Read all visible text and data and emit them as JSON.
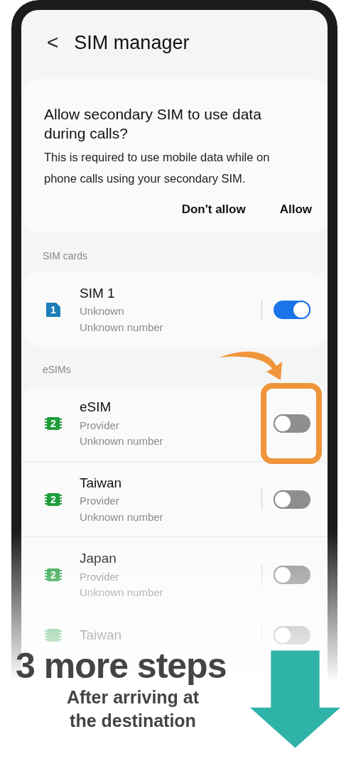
{
  "header": {
    "back": "<",
    "title": "SIM manager"
  },
  "dialog": {
    "title": "Allow secondary SIM to use data during calls?",
    "body": "This is required to use mobile data while on phone calls using your secondary SIM.",
    "buttons": [
      "Don't allow",
      "Allow"
    ]
  },
  "sections": [
    {
      "label": "SIM cards",
      "items": [
        {
          "kind": "sim",
          "slot": "1",
          "name": "SIM 1",
          "provider": "Unknown",
          "number": "Unknown number",
          "on": true,
          "highlighted": false
        }
      ]
    },
    {
      "label": "eSIMs",
      "items": [
        {
          "kind": "esim",
          "slot": "2",
          "name": "eSIM",
          "provider": "Provider",
          "number": "Unknown number",
          "on": false,
          "highlighted": true
        },
        {
          "kind": "esim",
          "slot": "2",
          "name": "Taiwan",
          "provider": "Provider",
          "number": "Unknown number",
          "on": false,
          "highlighted": false
        },
        {
          "kind": "esim",
          "slot": "2",
          "name": "Japan",
          "provider": "Provider",
          "number": "Unknown number",
          "on": false,
          "highlighted": false
        },
        {
          "kind": "esim",
          "name": "Taiwan",
          "on": false,
          "highlighted": false
        }
      ]
    }
  ],
  "caption": {
    "title": "3 more steps",
    "lines": [
      "After arriving at",
      "the destination"
    ]
  }
}
